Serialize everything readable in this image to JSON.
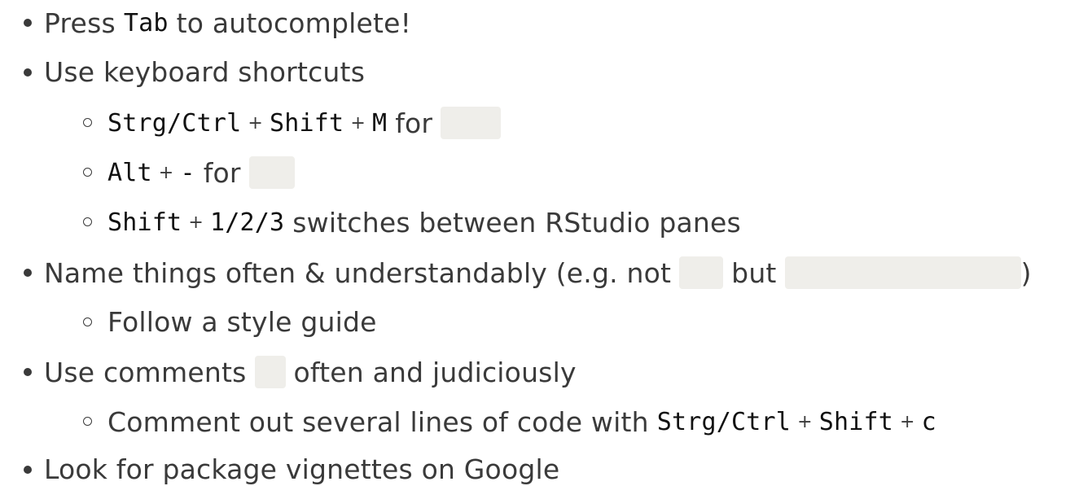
{
  "bullets": [
    {
      "pre": "Press",
      "key": "Tab",
      "post": "to autocomplete!"
    },
    {
      "text": "Use keyboard shortcuts"
    },
    {
      "keys": [
        "Strg/Ctrl",
        "Shift",
        "M"
      ],
      "plus": "+",
      "post": "for"
    },
    {
      "keys": [
        "Alt",
        "-"
      ],
      "plus": "+",
      "post": "for"
    },
    {
      "keys": [
        "Shift",
        "1/2/3"
      ],
      "plus": "+",
      "post": "switches between RStudio panes"
    },
    {
      "pre": "Name things often & understandably (e.g. not",
      "mid": "but",
      "post": ")"
    },
    {
      "text": "Follow a style guide"
    },
    {
      "pre": "Use comments",
      "post": "often and judiciously"
    },
    {
      "pre": "Comment out several lines of code with",
      "keys": [
        "Strg/Ctrl",
        "Shift",
        "c"
      ],
      "plus": "+"
    },
    {
      "text": "Look for package vignettes on Google"
    }
  ]
}
